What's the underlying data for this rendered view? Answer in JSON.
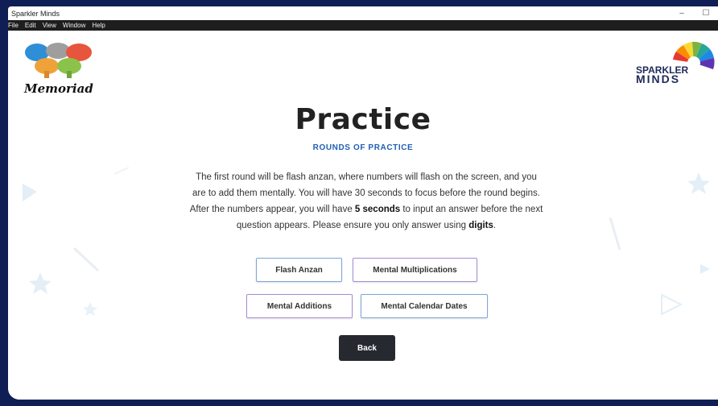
{
  "window": {
    "title": "Sparkler Minds",
    "controls": {
      "minimize": "–",
      "maximize": "☐"
    }
  },
  "menu": [
    "File",
    "Edit",
    "View",
    "Window",
    "Help"
  ],
  "logos": {
    "left": {
      "text": "Memoriad",
      "colors": [
        "#2f8fd6",
        "#f0a23a",
        "#8bc34a",
        "#e8553d",
        "#9e9e9e"
      ]
    },
    "right": {
      "text_line1": "SPARKLER",
      "text_line2": "MINDS"
    }
  },
  "page": {
    "title": "Practice",
    "subtitle": "ROUNDS OF PRACTICE",
    "description": {
      "part1": "The first round will be flash anzan, where numbers will flash on the screen, and you are to add them mentally. You will have 30 seconds to focus before the round begins. After the numbers appear, you will have ",
      "bold1": "5 seconds",
      "part2": " to input an answer before the next question appears. Please ensure you only answer using ",
      "bold2": "digits",
      "part3": "."
    }
  },
  "buttons": {
    "flash_anzan": "Flash Anzan",
    "mental_multiplications": "Mental Multiplications",
    "mental_additions": "Mental Additions",
    "mental_calendar_dates": "Mental Calendar Dates",
    "back": "Back"
  },
  "colors": {
    "background": "#0f1f55",
    "subtitle": "#1f5fb3",
    "back_button": "#262a30"
  }
}
